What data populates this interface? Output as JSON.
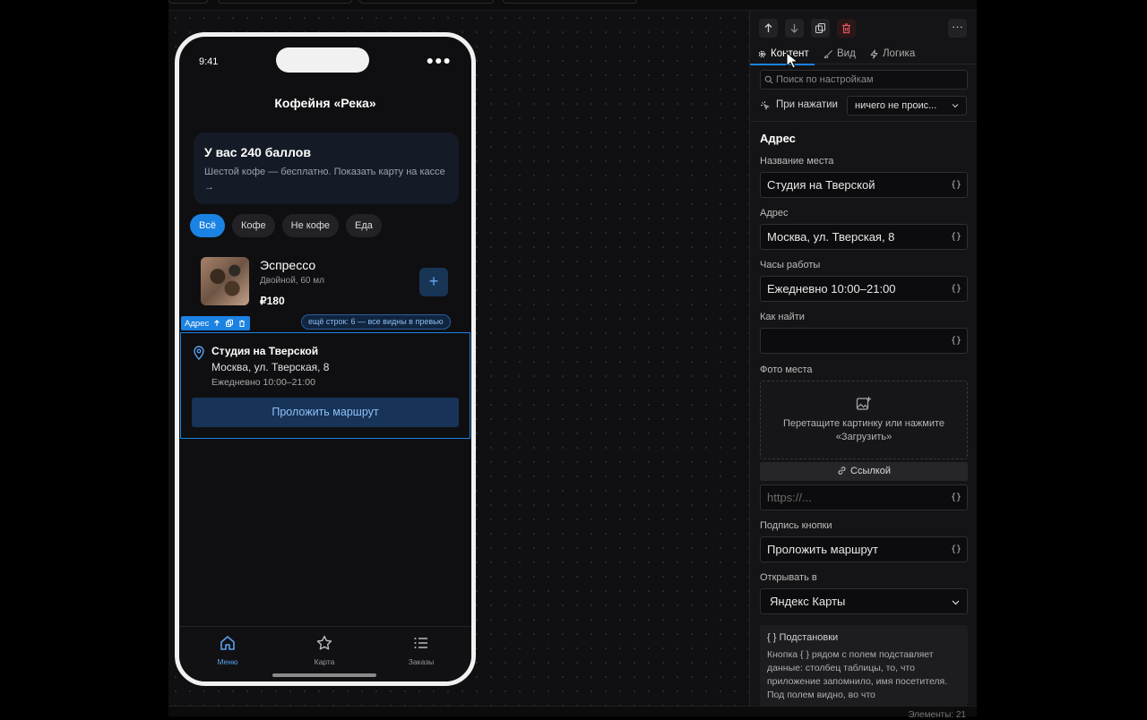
{
  "phone": {
    "time": "9:41",
    "status_dots": "●●●",
    "title": "Кофейня «Река»",
    "points_card": {
      "title": "У вас 240 баллов",
      "text": "Шестой кофе — бесплатно. Показать карту на кассе →"
    },
    "chips": [
      "Всё",
      "Кофе",
      "Не кофе",
      "Еда"
    ],
    "product": {
      "name": "Эспрессо",
      "desc": "Двойной, 60 мл",
      "price": "₽180",
      "add": "+"
    },
    "selection_tag": "Адрес",
    "more_rows_badge": "ещё строк: 6 — все видны в превью",
    "address_block": {
      "name": "Студия на Тверской",
      "address": "Москва, ул. Тверская, 8",
      "hours": "Ежедневно 10:00–21:00",
      "button": "Проложить маршрут"
    },
    "tabbar": [
      "Меню",
      "Карта",
      "Заказы"
    ]
  },
  "panel": {
    "tabs": [
      "Контент",
      "Вид",
      "Логика"
    ],
    "search_placeholder": "Поиск по настройкам",
    "on_press_label": "При нажатии",
    "on_press_value": "ничего не проис...",
    "section_title": "Адрес",
    "fields": {
      "place_name": {
        "label": "Название места",
        "value": "Студия на Тверской"
      },
      "address": {
        "label": "Адрес",
        "value": "Москва, ул. Тверская, 8"
      },
      "hours": {
        "label": "Часы работы",
        "value": "Ежедневно 10:00–21:00"
      },
      "how_to_find": {
        "label": "Как найти",
        "value": ""
      },
      "photo": {
        "label": "Фото места",
        "drop_text": "Перетащите картинку или нажмите «Загрузить»",
        "link_button": "Ссылкой",
        "url_placeholder": "https://..."
      },
      "button_caption": {
        "label": "Подпись кнопки",
        "value": "Проложить маршрут"
      },
      "open_in": {
        "label": "Открывать в",
        "value": "Яндекс Карты"
      }
    },
    "braces": "{}",
    "hint": {
      "title": "{ } Подстановки",
      "text": "Кнопка { } рядом с полем подставляет данные: столбец таблицы, то, что приложение запомнило, имя посетителя. Под полем видно, во что"
    },
    "more": "···"
  },
  "footer": {
    "elements_count": "Элементы: 21"
  },
  "colors": {
    "accent": "#1a82e2",
    "panel_bg": "#141416",
    "canvas_bg": "#101012",
    "danger": "#e0555a"
  }
}
